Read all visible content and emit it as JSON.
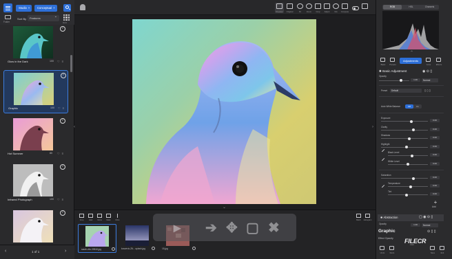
{
  "breadcrumb": {
    "chip1": "Studio",
    "chip2": "Conceptual"
  },
  "left": {
    "folder_label": "Folder",
    "grid_label": "Grid",
    "sort_label": "Sort By",
    "sort_value": "Features",
    "thumbs": [
      {
        "name": "Glow in the Dark",
        "pct": "100",
        "selected": false
      },
      {
        "name": "Graphic",
        "pct": "100",
        "selected": true
      },
      {
        "name": "Hot Summer",
        "pct": "80",
        "selected": false
      },
      {
        "name": "Infrared Photograph",
        "pct": "100",
        "selected": false
      },
      {
        "name": "",
        "pct": "",
        "selected": false
      }
    ],
    "pager": "1 of 1"
  },
  "toolbar": {
    "tools": [
      "Preview",
      "Original",
      "Fit",
      "Zoom",
      "Crop",
      "Adjust",
      "Info",
      "Compare"
    ]
  },
  "bottom_tools": [
    "Crop",
    "Heal",
    "Clone",
    "Mask",
    "More"
  ],
  "filmstrip": [
    {
      "name": "sarah-vito-39818.jpg",
      "selected": true
    },
    {
      "name": "koscevic-ZtL...splash.jpg",
      "selected": false
    },
    {
      "name": "15.jpg",
      "selected": false
    }
  ],
  "filmstrip_right": [
    "Batch",
    "Histogram"
  ],
  "right": {
    "hist_tabs": [
      "RGB",
      "HSL",
      "Channels"
    ],
    "tabs": [
      "Basic",
      "Presets",
      "Adjustments",
      "Color",
      "Effects"
    ],
    "active_tab": "Adjustments",
    "basic": {
      "title": "Basic Adjustment",
      "opacity_label": "Opacity",
      "opacity_value": "1.00",
      "blend_value": "Normal",
      "preset_label": "Preset",
      "preset_value": "Default",
      "awb_label": "Auto White Balance",
      "awb_on": "Off",
      "awb_off": "On",
      "sliders1": [
        {
          "label": "Exposure",
          "value": "0.00"
        },
        {
          "label": "Clarity",
          "value": "0.00"
        },
        {
          "label": "Shadows",
          "value": "0.00"
        },
        {
          "label": "Highlight",
          "value": "0.00"
        },
        {
          "label": "Black Level",
          "value": "0.00"
        },
        {
          "label": "White Level",
          "value": "0.00"
        }
      ],
      "sliders2": [
        {
          "label": "Saturation",
          "value": "0.00"
        },
        {
          "label": "Temperature",
          "value": "0.00"
        },
        {
          "label": "Tint",
          "value": "0.00"
        }
      ],
      "add_label": "Add"
    },
    "abstraction": {
      "title": "Abstraction",
      "opacity_label": "Opacity",
      "opacity_value": "1.00",
      "blend_value": "Normal"
    },
    "graphic_title": "Graphic",
    "blend_label": "Effect Opacity",
    "bottom_buttons": [
      "Undo",
      "Redo",
      "Save",
      "Exit"
    ]
  },
  "watermark": {
    "brand": "FILECR",
    "sub": ".com"
  },
  "colors": {
    "accent": "#2d6fd8",
    "panel": "#2a2a2c",
    "selection": "#3c7de0"
  }
}
